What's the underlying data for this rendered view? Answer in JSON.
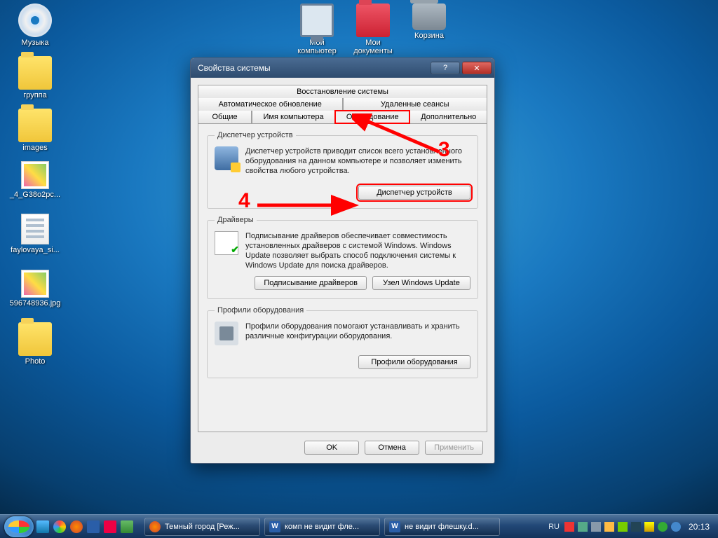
{
  "desktop_icons": {
    "music": "Музыка",
    "mycomputer": "Мой компьютер",
    "mydocs": "Мои документы",
    "trash": "Корзина",
    "gruppa": "группа",
    "images": "images",
    "file1": "_4_G38o2pc...",
    "file2": "faylovaya_si...",
    "pic1": "596748936.jpg",
    "photo": "Photo"
  },
  "dialog": {
    "title": "Свойства системы",
    "tabs": {
      "row1": {
        "a": "Восстановление системы"
      },
      "row2": {
        "a": "Автоматическое обновление",
        "b": "Удаленные сеансы"
      },
      "row3": {
        "a": "Общие",
        "b": "Имя компьютера",
        "c": "Оборудование",
        "d": "Дополнительно"
      }
    },
    "fs1": {
      "legend": "Диспетчер устройств",
      "text": "Диспетчер устройств приводит список всего установленного оборудования на данном компьютере и позволяет изменить свойства любого устройства.",
      "btn": "Диспетчер устройств"
    },
    "fs2": {
      "legend": "Драйверы",
      "text": "Подписывание драйверов обеспечивает совместимость установленных драйверов с системой Windows.  Windows Update позволяет выбрать способ подключения системы к Windows Update для поиска драйверов.",
      "btn1": "Подписывание драйверов",
      "btn2": "Узел Windows Update"
    },
    "fs3": {
      "legend": "Профили оборудования",
      "text": "Профили оборудования помогают устанавливать и хранить различные конфигурации оборудования.",
      "btn": "Профили оборудования"
    },
    "buttons": {
      "ok": "OK",
      "cancel": "Отмена",
      "apply": "Применить"
    }
  },
  "annotations": {
    "n3": "3",
    "n4": "4"
  },
  "taskbar": {
    "items": {
      "a": "Темный город [Реж...",
      "b": "комп не видит фле...",
      "c": "не видит флешку.d..."
    },
    "lang": "RU",
    "clock": "20:13"
  }
}
